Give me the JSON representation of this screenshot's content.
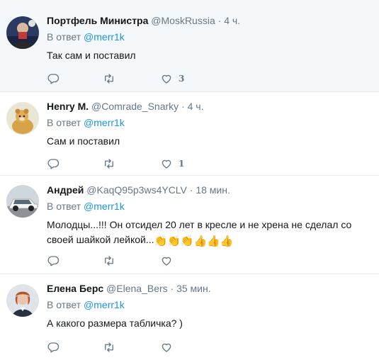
{
  "tweets": [
    {
      "name": "Портфель Министра",
      "handle": "@MoskRussia",
      "separator": "·",
      "time": "4 ч.",
      "reply_prefix": "В ответ",
      "reply_to": "@merr1k",
      "text": "Так сам и поставил",
      "like_count": "3"
    },
    {
      "name": "Henry M.",
      "handle": "@Comrade_Snarky",
      "separator": "·",
      "time": "4 ч.",
      "reply_prefix": "В ответ",
      "reply_to": "@merr1k",
      "text": "Сам и поставил",
      "like_count": "1"
    },
    {
      "name": "Андрей",
      "handle": "@KaqQ95p3ws4YCLV",
      "separator": "·",
      "time": "18 мин.",
      "reply_prefix": "В ответ",
      "reply_to": "@merr1k",
      "text": "Молодцы...!!! Он отсидел 20 лет в кресле и не хрена не сделал со своей шайкой лейкой...",
      "emoji": "👏👏👏👍👍👍",
      "like_count": ""
    },
    {
      "name": "Елена Берс",
      "handle": "@Elena_Bers",
      "separator": "·",
      "time": "35 мин.",
      "reply_prefix": "В ответ",
      "reply_to": "@merr1k",
      "text": "А какого размера табличка? )",
      "like_count": ""
    }
  ],
  "icons": {
    "reply": "reply-icon",
    "retweet": "retweet-icon",
    "like": "heart-icon"
  },
  "colors": {
    "link": "#1b95e0",
    "muted": "#657786",
    "highlight_bg": "#f5f8fa",
    "border": "#e6ecf0"
  }
}
